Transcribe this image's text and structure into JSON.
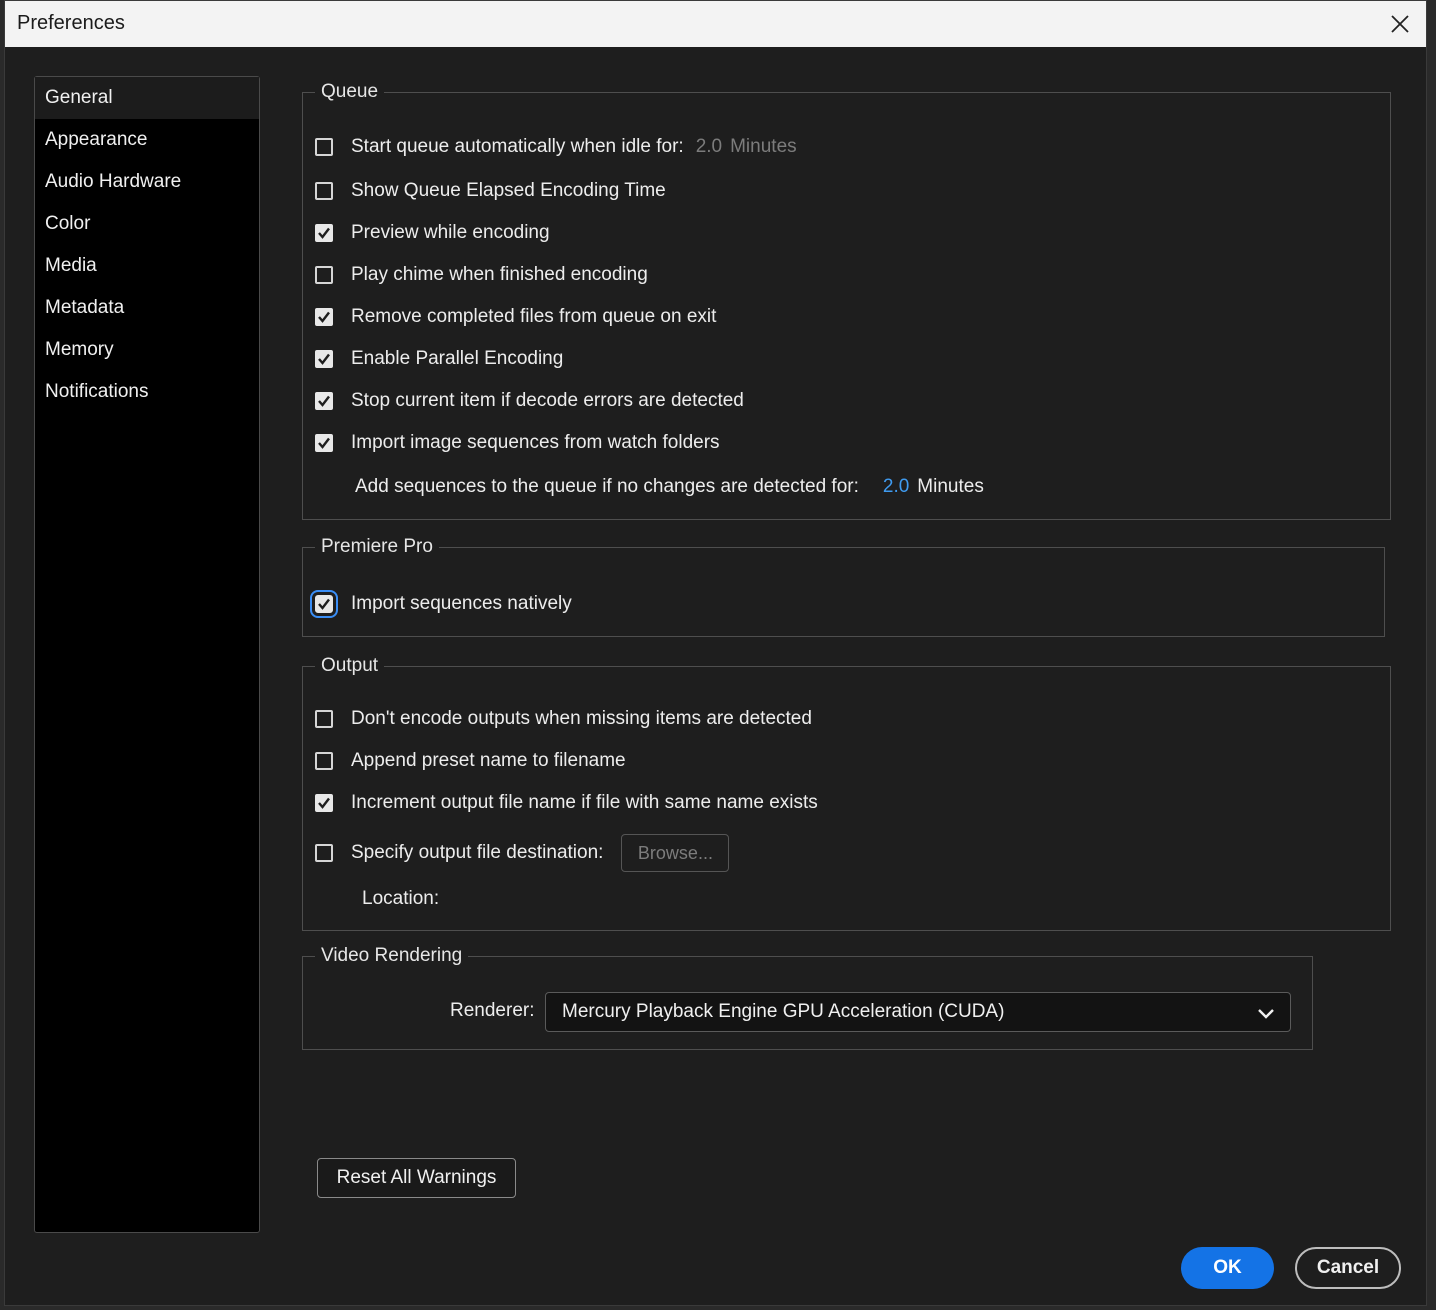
{
  "window": {
    "title": "Preferences",
    "close_icon": "close-icon"
  },
  "sidebar": {
    "items": [
      {
        "label": "General",
        "active": true
      },
      {
        "label": "Appearance",
        "active": false
      },
      {
        "label": "Audio Hardware",
        "active": false
      },
      {
        "label": "Color",
        "active": false
      },
      {
        "label": "Media",
        "active": false
      },
      {
        "label": "Metadata",
        "active": false
      },
      {
        "label": "Memory",
        "active": false
      },
      {
        "label": "Notifications",
        "active": false
      }
    ]
  },
  "queue": {
    "legend": "Queue",
    "options": [
      {
        "label": "Start queue automatically when idle for:",
        "checked": false
      },
      {
        "label": "Show Queue Elapsed Encoding Time",
        "checked": false
      },
      {
        "label": "Preview while encoding",
        "checked": true
      },
      {
        "label": "Play chime when finished encoding",
        "checked": false
      },
      {
        "label": "Remove completed files from queue on exit",
        "checked": true
      },
      {
        "label": "Enable Parallel Encoding",
        "checked": true
      },
      {
        "label": "Stop current item if decode errors are detected",
        "checked": true
      },
      {
        "label": "Import image sequences from watch folders",
        "checked": true
      }
    ],
    "idle_value": "2.0",
    "idle_unit": "Minutes",
    "sequences_label": "Add sequences to the queue if no changes are detected for:",
    "sequences_value": "2.0",
    "sequences_unit": "Minutes"
  },
  "premiere": {
    "legend": "Premiere Pro",
    "option": {
      "label": "Import sequences natively",
      "checked": true
    }
  },
  "output": {
    "legend": "Output",
    "options": [
      {
        "label": "Don't encode outputs when missing items are detected",
        "checked": false
      },
      {
        "label": "Append preset name to filename",
        "checked": false
      },
      {
        "label": "Increment output file name if file with same name exists",
        "checked": true
      },
      {
        "label": "Specify output file destination:",
        "checked": false
      }
    ],
    "browse_label": "Browse...",
    "location_label": "Location:"
  },
  "video": {
    "legend": "Video Rendering",
    "renderer_label": "Renderer:",
    "renderer_value": "Mercury Playback Engine GPU Acceleration (CUDA)"
  },
  "buttons": {
    "reset": "Reset All Warnings",
    "ok": "OK",
    "cancel": "Cancel"
  },
  "colors": {
    "accent": "#1473e6",
    "value_blue": "#3f9bf0",
    "background": "#1e1e1e"
  }
}
